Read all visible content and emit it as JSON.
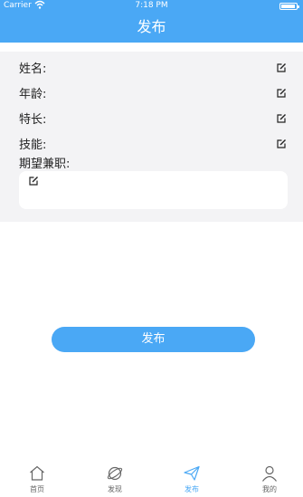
{
  "status_bar": {
    "carrier": "Carrier",
    "time": "7:18 PM"
  },
  "nav": {
    "title": "发布"
  },
  "form": {
    "fields": [
      {
        "label": "姓名:"
      },
      {
        "label": "年龄:"
      },
      {
        "label": "特长:"
      },
      {
        "label": "技能:"
      }
    ],
    "textarea_label": "期望兼职:"
  },
  "publish_button": {
    "label": "发布"
  },
  "tab_bar": {
    "items": [
      {
        "label": "首页",
        "icon": "home-icon"
      },
      {
        "label": "发现",
        "icon": "planet-icon"
      },
      {
        "label": "发布",
        "icon": "paper-plane-icon",
        "active": true
      },
      {
        "label": "我的",
        "icon": "user-icon"
      }
    ]
  },
  "colors": {
    "accent": "#4aa8f5",
    "form_background": "#f3f3f5",
    "text": "#222222",
    "tab_inactive": "#666666"
  }
}
